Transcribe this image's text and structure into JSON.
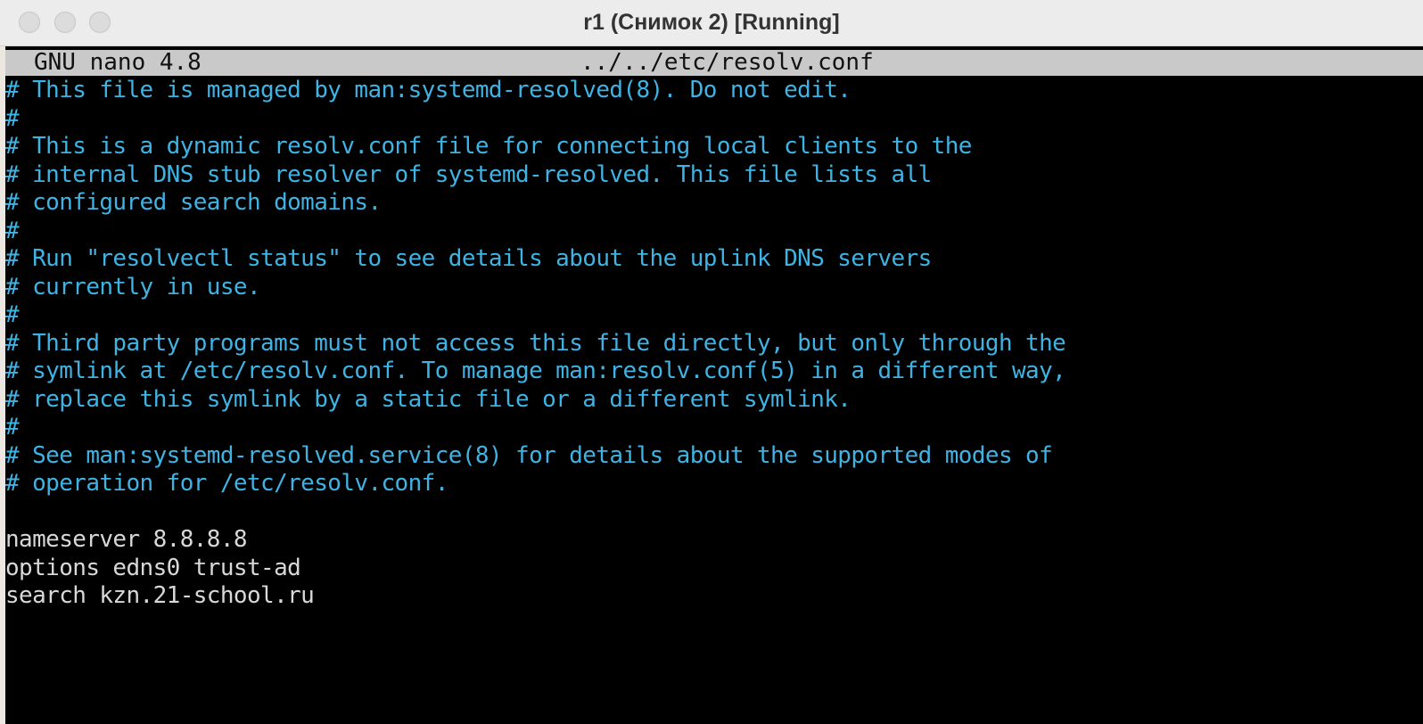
{
  "window": {
    "title": "r1 (Снимок 2) [Running]"
  },
  "nano": {
    "version": "GNU nano 4.8",
    "filename": "../../etc/resolv.conf"
  },
  "file_lines": [
    {
      "text": "# This file is managed by man:systemd-resolved(8). Do not edit.",
      "type": "comment"
    },
    {
      "text": "#",
      "type": "comment"
    },
    {
      "text": "# This is a dynamic resolv.conf file for connecting local clients to the",
      "type": "comment"
    },
    {
      "text": "# internal DNS stub resolver of systemd-resolved. This file lists all",
      "type": "comment"
    },
    {
      "text": "# configured search domains.",
      "type": "comment"
    },
    {
      "text": "#",
      "type": "comment"
    },
    {
      "text": "# Run \"resolvectl status\" to see details about the uplink DNS servers",
      "type": "comment"
    },
    {
      "text": "# currently in use.",
      "type": "comment"
    },
    {
      "text": "#",
      "type": "comment"
    },
    {
      "text": "# Third party programs must not access this file directly, but only through the",
      "type": "comment"
    },
    {
      "text": "# symlink at /etc/resolv.conf. To manage man:resolv.conf(5) in a different way,",
      "type": "comment"
    },
    {
      "text": "# replace this symlink by a static file or a different symlink.",
      "type": "comment"
    },
    {
      "text": "#",
      "type": "comment"
    },
    {
      "text": "# See man:systemd-resolved.service(8) for details about the supported modes of",
      "type": "comment"
    },
    {
      "text": "# operation for /etc/resolv.conf.",
      "type": "comment"
    },
    {
      "text": "",
      "type": "blank"
    },
    {
      "text": "nameserver 8.8.8.8",
      "type": "config"
    },
    {
      "text": "options edns0 trust-ad",
      "type": "config"
    },
    {
      "text": "search kzn.21-school.ru",
      "type": "config"
    }
  ],
  "colors": {
    "comment": "#3fb3e3",
    "config": "#d8d8d8",
    "background": "#000000",
    "header_bar": "#c9c9c9"
  }
}
